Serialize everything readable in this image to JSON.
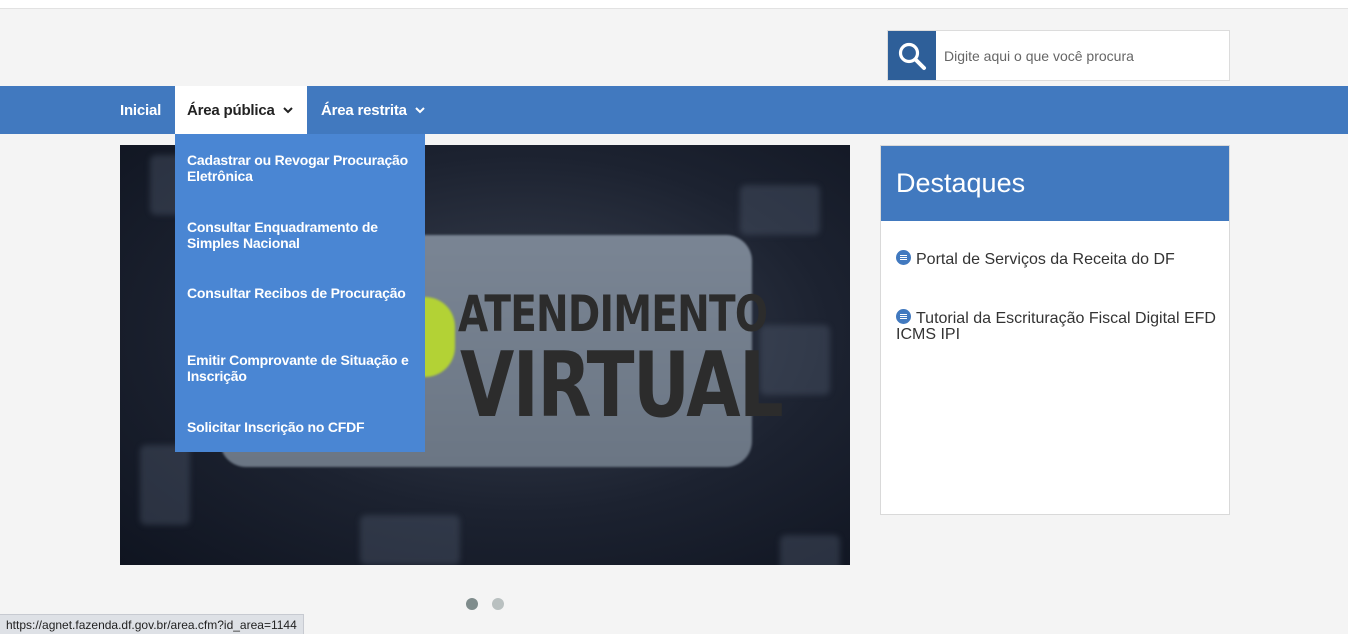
{
  "search": {
    "placeholder": "Digite aqui o que você procura",
    "icon": "search-icon"
  },
  "nav": [
    {
      "label": "Inicial"
    },
    {
      "label": "Área pública"
    },
    {
      "label": "Área restrita"
    }
  ],
  "dropdown": [
    {
      "label": "Cadastrar ou Revogar Procuração Eletrônica"
    },
    {
      "label": "Consultar Enquadramento de Simples Nacional"
    },
    {
      "label": "Consultar Recibos de Procuração"
    },
    {
      "label": "Emitir Comprovante de Situação e Inscrição"
    },
    {
      "label": "Solicitar Inscrição no CFDF"
    }
  ],
  "slide": {
    "line1": "ATENDIMENTO",
    "line2": "VIRTUAL"
  },
  "destaques": {
    "title": "Destaques",
    "items": [
      {
        "label": "Portal de Serviços da Receita do DF"
      },
      {
        "label": "Tutorial da Escrituração Fiscal Digital EFD ICMS IPI"
      }
    ]
  },
  "status_url": "https://agnet.fazenda.df.gov.br/area.cfm?id_area=1144",
  "colors": {
    "nav": "#4179bf",
    "dropdown": "#4a86d3",
    "search_button": "#2e5f99"
  }
}
